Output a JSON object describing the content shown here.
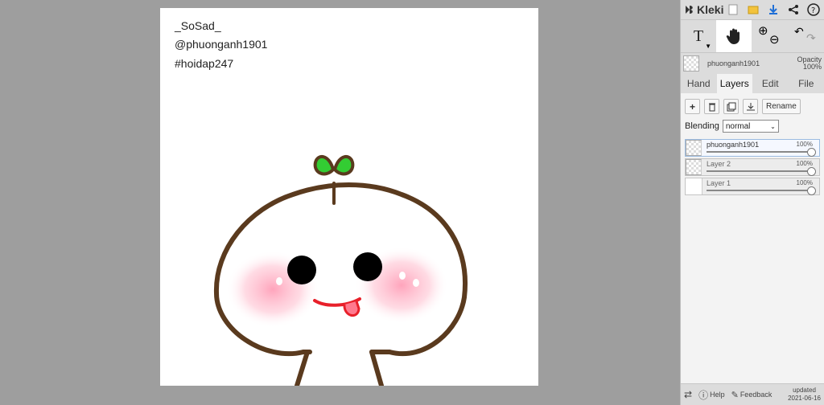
{
  "canvas": {
    "lines": [
      "_SoSad_",
      "@phuonganh1901",
      "#hoidap247"
    ]
  },
  "app": {
    "name": "Kleki",
    "icons": [
      "new-image-icon",
      "open-icon",
      "download-icon",
      "share-icon",
      "help-icon"
    ]
  },
  "tools": {
    "text_label": "T"
  },
  "current_layer": {
    "name": "phuonganh1901",
    "opacity_label": "Opacity",
    "opacity_value": "100%"
  },
  "tabs": [
    {
      "label": "Hand"
    },
    {
      "label": "Layers"
    },
    {
      "label": "Edit"
    },
    {
      "label": "File"
    }
  ],
  "layers_panel": {
    "rename_label": "Rename",
    "blending_label": "Blending",
    "blending_value": "normal",
    "layers": [
      {
        "name": "phuonganh1901",
        "opacity": "100%"
      },
      {
        "name": "Layer 2",
        "opacity": "100%"
      },
      {
        "name": "Layer 1",
        "opacity": "100%"
      }
    ]
  },
  "footer": {
    "help_label": "Help",
    "feedback_label": "Feedback",
    "updated_label": "updated",
    "updated_date": "2021-06-16"
  },
  "colors": {
    "workspace": "#9e9e9e",
    "outline": "#5a3a1e",
    "leaf": "#33cc33",
    "blush": "#ffb6c8",
    "tongue": "#e8202a"
  }
}
